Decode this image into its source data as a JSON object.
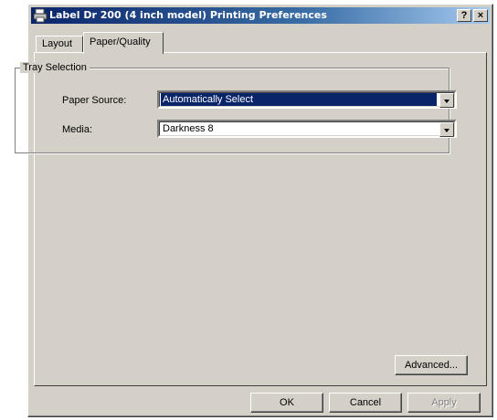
{
  "window": {
    "title": "Label Dr 200 (4 inch model) Printing Preferences"
  },
  "titlebar_buttons": {
    "help": "?",
    "close": "×"
  },
  "tabs": [
    {
      "label": "Layout"
    },
    {
      "label": "Paper/Quality"
    }
  ],
  "tray_selection": {
    "legend": "Tray Selection",
    "paper_source": {
      "label": "Paper Source:",
      "value": "Automatically Select"
    },
    "media": {
      "label": "Media:",
      "value": "Darkness 8"
    }
  },
  "buttons": {
    "advanced": "Advanced...",
    "ok": "OK",
    "cancel": "Cancel",
    "apply": "Apply"
  },
  "colors": {
    "titlebar": "#0a246a",
    "selection": "#0a246a",
    "face": "#d4d0c8"
  }
}
